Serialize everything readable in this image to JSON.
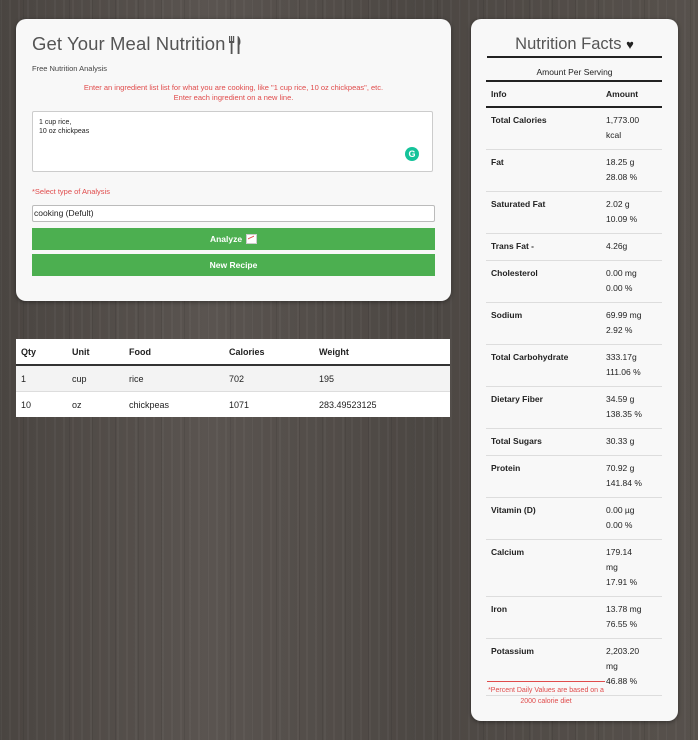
{
  "app": {
    "title": "Get Your Meal Nutrition",
    "subtitle": "Free Nutrition Analysis",
    "hint_line1": "Enter an ingredient list list for what you are cooking, like \"1 cup rice, 10 oz chickpeas\", etc.",
    "hint_line2": "Enter each ingredient on a new line.",
    "ingredients_value": "1 cup rice,\n10 oz chickpeas",
    "select_label": "*Select type of Analysis",
    "select_value": "cooking (Defult)",
    "analyze_label": "Analyze",
    "new_recipe_label": "New Recipe"
  },
  "ingredients_table": {
    "headers": [
      "Qty",
      "Unit",
      "Food",
      "Calories",
      "Weight"
    ],
    "rows": [
      [
        "1",
        "cup",
        "rice",
        "702",
        "195"
      ],
      [
        "10",
        "oz",
        "chickpeas",
        "1071",
        "283.49523125"
      ]
    ]
  },
  "nutrition_facts": {
    "title": "Nutrition Facts",
    "subtitle": "Amount Per Serving",
    "headers": [
      "Info",
      "Amount"
    ],
    "rows": [
      {
        "name": "Total Calories",
        "amount": "1,773.00\nkcal"
      },
      {
        "name": "Fat",
        "amount": "18.25 g\n28.08 %"
      },
      {
        "name": "Saturated Fat",
        "amount": "2.02 g\n10.09 %"
      },
      {
        "name": "Trans Fat -",
        "amount": "4.26g"
      },
      {
        "name": "Cholesterol",
        "amount": "0.00 mg\n0.00 %"
      },
      {
        "name": "Sodium",
        "amount": "69.99 mg\n2.92 %"
      },
      {
        "name": "Total Carbohydrate",
        "amount": "333.17g\n111.06 %"
      },
      {
        "name": "Dietary Fiber",
        "amount": "34.59 g\n138.35 %"
      },
      {
        "name": "Total Sugars",
        "amount": "30.33 g"
      },
      {
        "name": "Protein",
        "amount": "70.92 g\n141.84 %"
      },
      {
        "name": "Vitamin (D)",
        "amount": "0.00 µg\n0.00 %"
      },
      {
        "name": "Calcium",
        "amount": "179.14\nmg\n17.91 %"
      },
      {
        "name": "Iron",
        "amount": "13.78 mg\n76.55 %"
      },
      {
        "name": "Potassium",
        "amount": "2,203.20\nmg\n46.88 %"
      }
    ],
    "footnote": "*Percent Daily Values are based on a 2000 calorie diet"
  },
  "colors": {
    "accent_green": "#4caf50",
    "alert_red": "#e04b4b"
  }
}
